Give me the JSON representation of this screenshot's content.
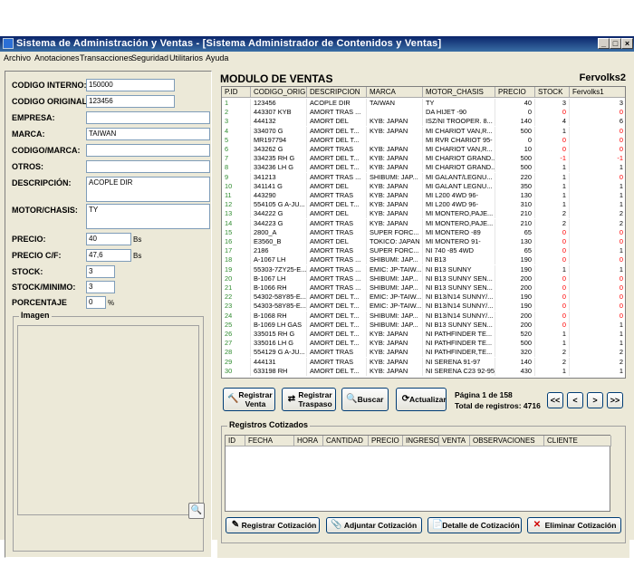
{
  "window": {
    "title": "Sistema de Administración y Ventas - [Sistema Administrador de Contenidos y Ventas]"
  },
  "menu": [
    "Archivo",
    "Anotaciones",
    "Transacciones",
    "Seguridad",
    "Utilitarios",
    "Ayuda"
  ],
  "form": {
    "codigo_interno": {
      "label": "CODIGO INTERNO:",
      "value": "150000"
    },
    "codigo_original": {
      "label": "CODIGO ORIGINAL:",
      "value": "123456"
    },
    "empresa": {
      "label": "EMPRESA:",
      "value": ""
    },
    "marca": {
      "label": "MARCA:",
      "value": "TAIWAN"
    },
    "codigo_marca": {
      "label": "CODIGO/MARCA:",
      "value": ""
    },
    "otros": {
      "label": "OTROS:",
      "value": ""
    },
    "descripcion": {
      "label": "DESCRIPCIÓN:",
      "value": "ACOPLE DIR"
    },
    "motor_chasis": {
      "label": "MOTOR/CHASIS:",
      "value": "TY"
    },
    "precio": {
      "label": "PRECIO:",
      "value": "40",
      "unit": "Bs"
    },
    "precio_cf": {
      "label": "PRECIO C/F:",
      "value": "47,6",
      "unit": "Bs"
    },
    "stock": {
      "label": "STOCK:",
      "value": "3"
    },
    "stock_minimo": {
      "label": "STOCK/MINIMO:",
      "value": "3"
    },
    "porcentaje": {
      "label": "PORCENTAJE",
      "value": "0",
      "unit": "%"
    },
    "imagen_label": "Imagen"
  },
  "main": {
    "title": "MODULO DE VENTAS",
    "user": "Fervolks2",
    "columns": [
      "P.ID",
      "CODIGO_ORIG",
      "DESCRIPCION",
      "MARCA",
      "MOTOR_CHASIS",
      "PRECIO",
      "STOCK",
      "Fervolks1"
    ],
    "rows": [
      [
        "1",
        "123456",
        "ACOPLE DIR",
        "TAIWAN",
        "TY",
        "40",
        "3",
        "3"
      ],
      [
        "2",
        "443307 KYB",
        "AMORT TRAS ...",
        "",
        "DA HIJET -90",
        "0",
        "0",
        "0"
      ],
      [
        "3",
        "444132",
        "AMORT DEL",
        "KYB: JAPAN",
        "ISZ/NI TROOPER. 8...",
        "140",
        "4",
        "6"
      ],
      [
        "4",
        "334070 G",
        "AMORT DEL T...",
        "KYB: JAPAN",
        "MI CHARIOT VAN,R...",
        "500",
        "1",
        "0"
      ],
      [
        "5",
        "MR197794",
        "AMORT DEL T...",
        "",
        "MI RVR CHARIOT 95-",
        "0",
        "0",
        "0"
      ],
      [
        "6",
        "343262 G",
        "AMORT TRAS",
        "KYB: JAPAN",
        "MI CHARIOT VAN,R...",
        "10",
        "0",
        "0"
      ],
      [
        "7",
        "334235 RH G",
        "AMORT DEL T...",
        "KYB: JAPAN",
        "MI CHARIOT GRAND...",
        "500",
        "-1",
        "-1"
      ],
      [
        "8",
        "334236 LH G",
        "AMORT DEL T...",
        "KYB: JAPAN",
        "MI CHARIOT GRAND...",
        "500",
        "1",
        "1"
      ],
      [
        "9",
        "341213",
        "AMORT TRAS ...",
        "SHIBUMI: JAP...",
        "MI GALANT/LEGNU...",
        "220",
        "1",
        "0"
      ],
      [
        "10",
        "341141 G",
        "AMORT DEL",
        "KYB: JAPAN",
        "MI GALANT LEGNU...",
        "350",
        "1",
        "1"
      ],
      [
        "11",
        "443290",
        "AMORT TRAS",
        "KYB: JAPAN",
        "MI L200 4WD 96-",
        "130",
        "1",
        "1"
      ],
      [
        "12",
        "554105 G A-JU...",
        "AMORT DEL T...",
        "KYB: JAPAN",
        "MI L200 4WD 96-",
        "310",
        "1",
        "1"
      ],
      [
        "13",
        "344222 G",
        "AMORT DEL",
        "KYB: JAPAN",
        "MI MONTERO,PAJE...",
        "210",
        "2",
        "2"
      ],
      [
        "14",
        "344223 G",
        "AMORT TRAS",
        "KYB: JAPAN",
        "MI MONTERO,PAJE...",
        "210",
        "2",
        "2"
      ],
      [
        "15",
        "2800_A",
        "AMORT TRAS",
        "SUPER FORC...",
        "MI MONTERO -89",
        "65",
        "0",
        "0"
      ],
      [
        "16",
        "E3560_B",
        "AMORT DEL",
        "TOKICO: JAPAN",
        "MI MONTERO 91-",
        "130",
        "0",
        "0"
      ],
      [
        "17",
        "2186",
        "AMORT TRAS",
        "SUPER FORC...",
        "NI 740 -85 4WD",
        "65",
        "0",
        "1"
      ],
      [
        "18",
        "A-1067 LH",
        "AMORT TRAS ...",
        "SHIBUMI: JAP...",
        "NI B13",
        "190",
        "0",
        "0"
      ],
      [
        "19",
        "55303-7ZY25-E...",
        "AMORT TRAS ...",
        "EMIC: JP-TAIW...",
        "NI B13 SUNNY",
        "190",
        "1",
        "1"
      ],
      [
        "20",
        "B-1067 LH",
        "AMORT TRAS ...",
        "SHIBUMI: JAP...",
        "NI B13 SUNNY SEN...",
        "200",
        "0",
        "0"
      ],
      [
        "21",
        "B-1066 RH",
        "AMORT TRAS ...",
        "SHIBUMI: JAP...",
        "NI B13 SUNNY SEN...",
        "200",
        "0",
        "0"
      ],
      [
        "22",
        "54302-58Y85-E...",
        "AMORT DEL T...",
        "EMIC: JP-TAIW...",
        "NI B13/N14 SUNNY/...",
        "190",
        "0",
        "0"
      ],
      [
        "23",
        "54303-58Y85-E...",
        "AMORT DEL T...",
        "EMIC: JP-TAIW...",
        "NI B13/N14 SUNNY/...",
        "190",
        "0",
        "0"
      ],
      [
        "24",
        "B-1068 RH",
        "AMORT DEL T...",
        "SHIBUMI: JAP...",
        "NI B13/N14 SUNNY/...",
        "200",
        "0",
        "0"
      ],
      [
        "25",
        "B-1069 LH GAS",
        "AMORT DEL T...",
        "SHIBUMI: JAP...",
        "NI B13 SUNNY SEN...",
        "200",
        "0",
        "1"
      ],
      [
        "26",
        "335015 RH G",
        "AMORT DEL T...",
        "KYB: JAPAN",
        "NI PATHFINDER TE...",
        "520",
        "1",
        "1"
      ],
      [
        "27",
        "335016 LH G",
        "AMORT DEL T...",
        "KYB: JAPAN",
        "NI PATHFINDER TE...",
        "500",
        "1",
        "1"
      ],
      [
        "28",
        "554129 G A-JU...",
        "AMORT TRAS",
        "KYB: JAPAN",
        "NI PATHFINDER,TE...",
        "320",
        "2",
        "2"
      ],
      [
        "29",
        "444131",
        "AMORT TRAS",
        "KYB: JAPAN",
        "NI SERENA 91-97",
        "140",
        "2",
        "2"
      ],
      [
        "30",
        "633198 RH",
        "AMORT DEL T...",
        "KYB: JAPAN",
        "NI SERENA C23 92-95",
        "430",
        "1",
        "1"
      ]
    ],
    "buttons": {
      "registrar_venta": [
        "Registrar",
        "Venta"
      ],
      "registrar_traspaso": [
        "Registrar",
        "Traspaso"
      ],
      "buscar": "Buscar",
      "actualizar": "Actualizar"
    },
    "pagination": {
      "page_text": "Página 1 de 158",
      "total_text": "Total de registros: 4716",
      "first": "<<",
      "prev": "<",
      "next": ">",
      "last": ">>"
    },
    "cotizados": {
      "title": "Registros Cotizados",
      "columns": [
        "ID",
        "FECHA",
        "HORA",
        "CANTIDAD",
        "PRECIO",
        "INGRESO",
        "VENTA",
        "OBSERVACIONES",
        "CLIENTE"
      ],
      "buttons": {
        "registrar": "Registrar Cotización",
        "adjuntar": "Adjuntar Cotización",
        "detalle": "Detalle de Cotización",
        "eliminar": "Eliminar Cotización"
      }
    }
  },
  "colors": {
    "negative_stock": "#ff0000",
    "pid_green": "#2e8b2e",
    "titlebar": "#0a246a"
  }
}
